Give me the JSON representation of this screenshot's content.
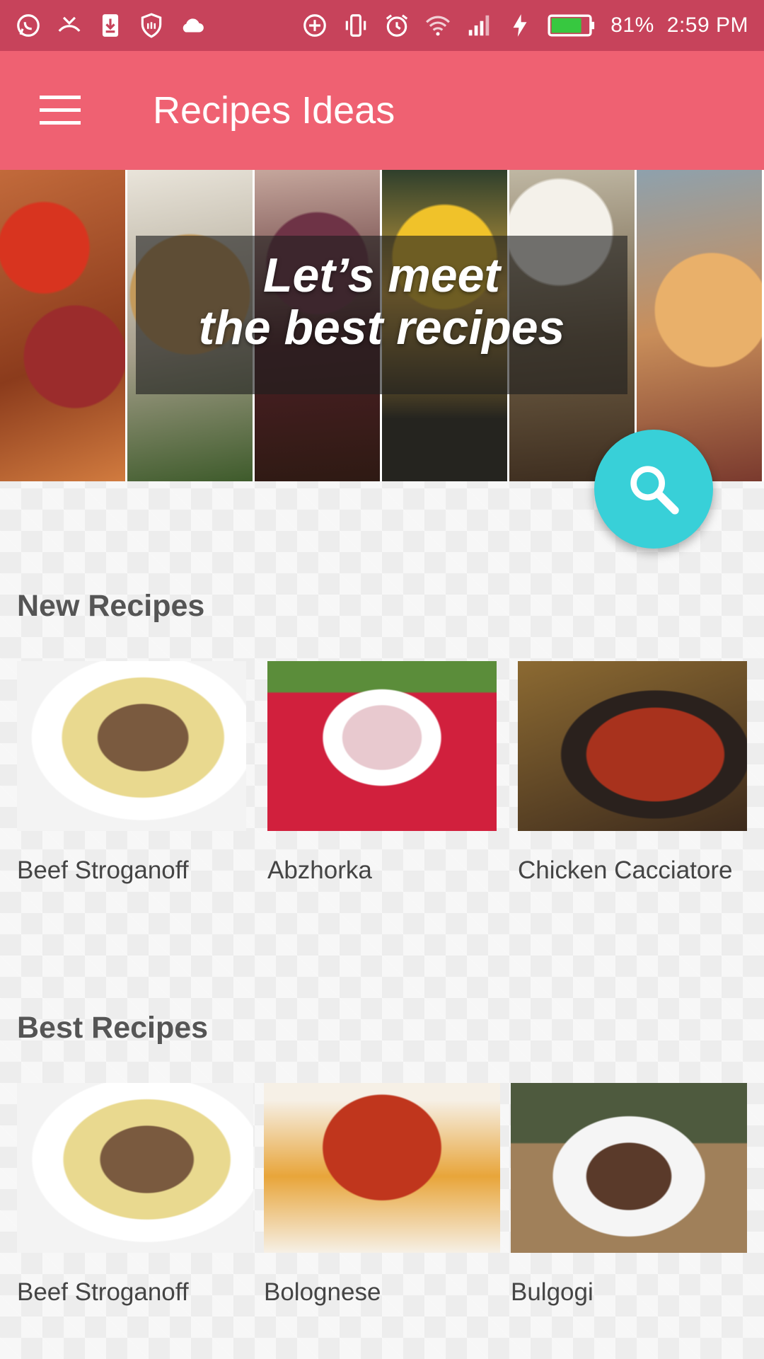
{
  "status_bar": {
    "left_icons": [
      "whatsapp-icon",
      "missed-call-icon",
      "download-icon",
      "shield-icon",
      "cloud-icon"
    ],
    "right_icons": [
      "data-saver-icon",
      "vibrate-icon",
      "alarm-icon",
      "wifi-icon",
      "signal-icon",
      "charging-icon",
      "battery-icon"
    ],
    "battery": "81%",
    "battery_level": 0.81,
    "time": "2:59 PM"
  },
  "app_bar": {
    "title": "Recipes Ideas",
    "menu_icon": "hamburger-menu-icon"
  },
  "hero": {
    "line1": "Let’s meet",
    "line2": "the best recipes"
  },
  "fab": {
    "icon": "search-icon",
    "color": "#38d0d8"
  },
  "sections": {
    "new": {
      "title": "New Recipes",
      "items": [
        {
          "label": "Beef Stroganoff"
        },
        {
          "label": "Abzhorka"
        },
        {
          "label": "Chicken Cacciatore"
        }
      ]
    },
    "best": {
      "title": "Best Recipes",
      "items": [
        {
          "label": "Beef Stroganoff"
        },
        {
          "label": "Bolognese"
        },
        {
          "label": "Bulgogi"
        }
      ]
    }
  },
  "colors": {
    "status_bar": "#c7435b",
    "app_bar": "#ef6172",
    "accent": "#38d0d8"
  }
}
